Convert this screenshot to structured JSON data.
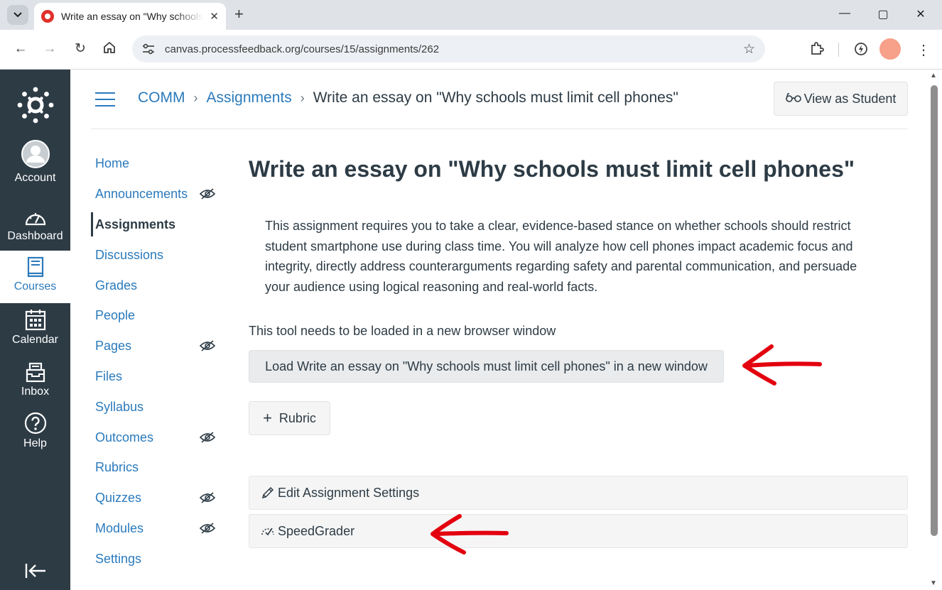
{
  "browser": {
    "tab_title": "Write an essay on \"Why schools must limit cell phones\"",
    "url": "canvas.processfeedback.org/courses/15/assignments/262"
  },
  "global_nav": {
    "items": [
      {
        "label": "Account",
        "icon": "account-icon"
      },
      {
        "label": "Dashboard",
        "icon": "dashboard-icon"
      },
      {
        "label": "Courses",
        "icon": "courses-icon",
        "active": true
      },
      {
        "label": "Calendar",
        "icon": "calendar-icon"
      },
      {
        "label": "Inbox",
        "icon": "inbox-icon"
      },
      {
        "label": "Help",
        "icon": "help-icon"
      }
    ],
    "active_color": "#2b7abc",
    "background": "#2d3b45"
  },
  "breadcrumb": {
    "course": "COMM",
    "section": "Assignments",
    "current": "Write an essay on \"Why schools must limit cell phones\""
  },
  "header": {
    "view_as_student": "View as Student"
  },
  "course_nav": {
    "items": [
      {
        "label": "Home",
        "hidden": false
      },
      {
        "label": "Announcements",
        "hidden": true
      },
      {
        "label": "Assignments",
        "hidden": false,
        "active": true
      },
      {
        "label": "Discussions",
        "hidden": false
      },
      {
        "label": "Grades",
        "hidden": false
      },
      {
        "label": "People",
        "hidden": false
      },
      {
        "label": "Pages",
        "hidden": true
      },
      {
        "label": "Files",
        "hidden": false
      },
      {
        "label": "Syllabus",
        "hidden": false
      },
      {
        "label": "Outcomes",
        "hidden": true
      },
      {
        "label": "Rubrics",
        "hidden": false
      },
      {
        "label": "Quizzes",
        "hidden": true
      },
      {
        "label": "Modules",
        "hidden": true
      },
      {
        "label": "Settings",
        "hidden": false
      }
    ]
  },
  "assignment": {
    "title": "Write an essay on \"Why schools must limit cell phones\"",
    "description": "This assignment requires you to take a clear, evidence-based stance on whether schools should restrict student smartphone use during class time. You will analyze how cell phones impact academic focus and integrity, directly address counterarguments regarding safety and parental communication, and persuade your audience using logical reasoning and real-world facts.",
    "tool_note": "This tool needs to be loaded in a new browser window",
    "load_button": "Load Write an essay on \"Why schools must limit cell phones\" in a new window",
    "rubric_button": "Rubric"
  },
  "sidebar_actions": {
    "edit_settings": "Edit Assignment Settings",
    "speedgrader": "SpeedGrader"
  },
  "annotations": {
    "arrow_color": "#e3000f"
  }
}
